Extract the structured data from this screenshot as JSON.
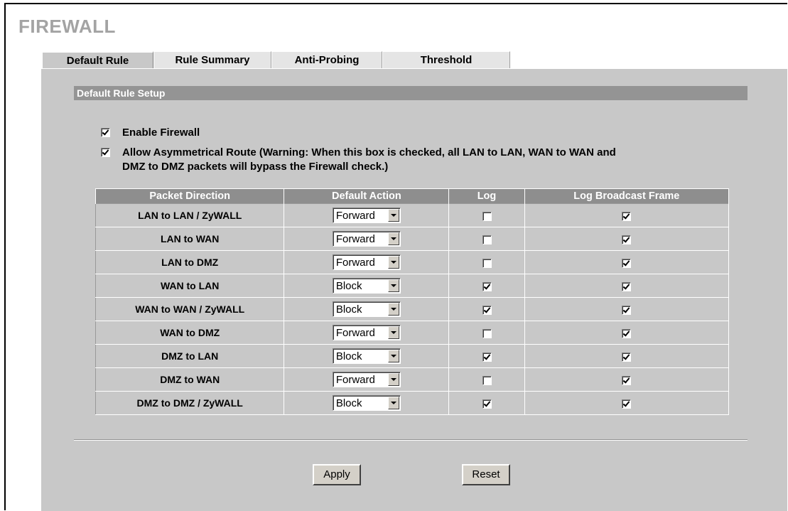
{
  "page": {
    "title": "FIREWALL"
  },
  "tabs": [
    {
      "label": "Default Rule",
      "active": true
    },
    {
      "label": "Rule Summary",
      "active": false
    },
    {
      "label": "Anti-Probing",
      "active": false
    },
    {
      "label": "Threshold",
      "active": false
    }
  ],
  "section": {
    "header": "Default Rule Setup"
  },
  "options": {
    "enable_firewall": {
      "label": "Enable Firewall",
      "checked": true
    },
    "asymmetrical_route": {
      "line1": "Allow Asymmetrical Route (Warning: When this box is checked, all LAN to LAN, WAN to WAN and",
      "line2": "DMZ to DMZ packets will bypass the Firewall check.)",
      "checked": true
    }
  },
  "table": {
    "headers": [
      "Packet Direction",
      "Default Action",
      "Log",
      "Log Broadcast Frame"
    ],
    "rows": [
      {
        "direction": "LAN to LAN / ZyWALL",
        "action": "Forward",
        "log": false,
        "log_broadcast": true
      },
      {
        "direction": "LAN to WAN",
        "action": "Forward",
        "log": false,
        "log_broadcast": true
      },
      {
        "direction": "LAN to DMZ",
        "action": "Forward",
        "log": false,
        "log_broadcast": true
      },
      {
        "direction": "WAN to LAN",
        "action": "Block",
        "log": true,
        "log_broadcast": true
      },
      {
        "direction": "WAN to WAN / ZyWALL",
        "action": "Block",
        "log": true,
        "log_broadcast": true
      },
      {
        "direction": "WAN to DMZ",
        "action": "Forward",
        "log": false,
        "log_broadcast": true
      },
      {
        "direction": "DMZ to LAN",
        "action": "Block",
        "log": true,
        "log_broadcast": true
      },
      {
        "direction": "DMZ to WAN",
        "action": "Forward",
        "log": false,
        "log_broadcast": true
      },
      {
        "direction": "DMZ to DMZ / ZyWALL",
        "action": "Block",
        "log": true,
        "log_broadcast": true
      }
    ]
  },
  "buttons": {
    "apply": "Apply",
    "reset": "Reset"
  },
  "colors": {
    "panel": "#c8c8c8",
    "header_bar": "#949494",
    "title": "#a3a3a3"
  }
}
